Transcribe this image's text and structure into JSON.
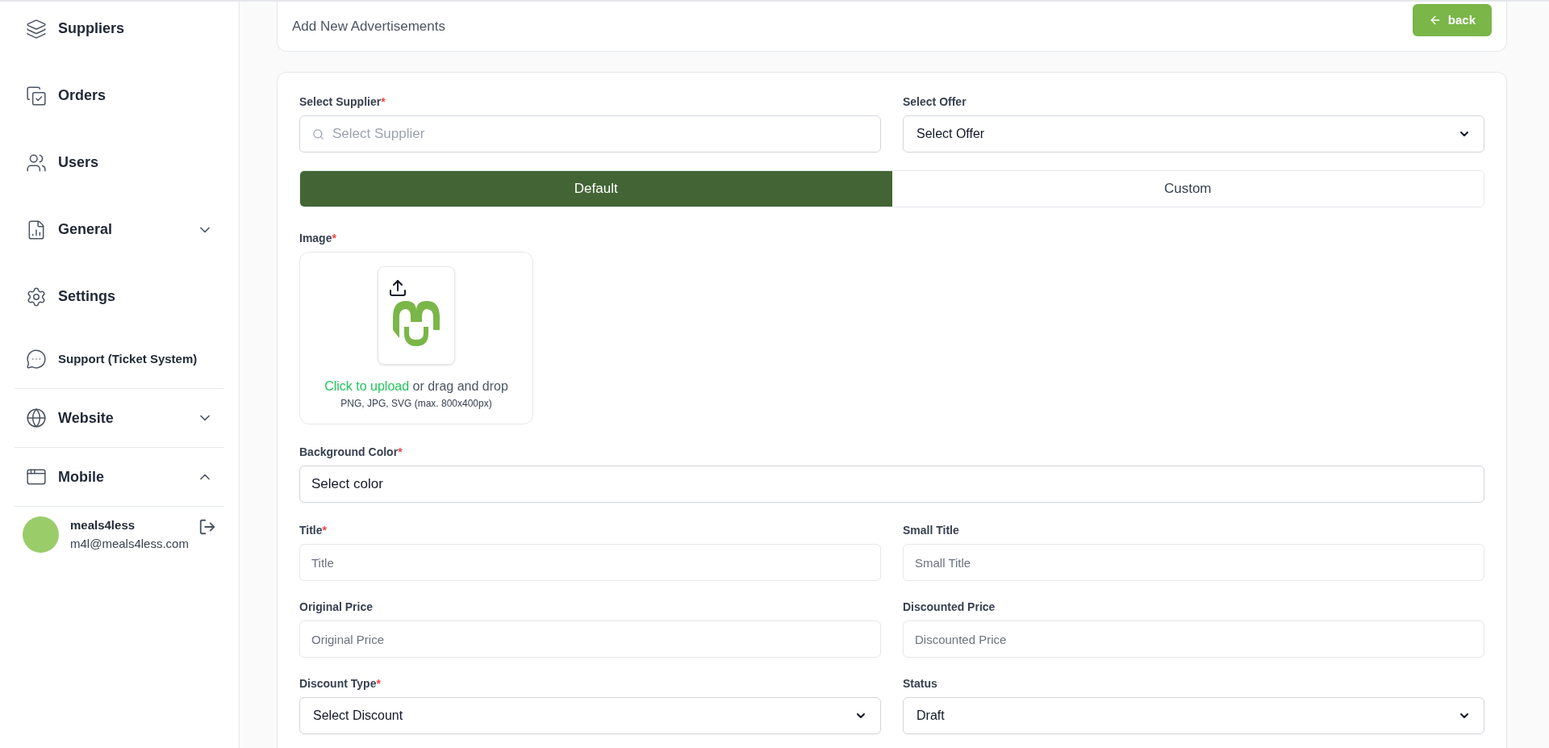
{
  "sidebar": {
    "items": [
      {
        "label": "Suppliers",
        "kind": "link",
        "selected": false
      },
      {
        "label": "Orders",
        "kind": "link",
        "selected": false
      },
      {
        "label": "Users",
        "kind": "link",
        "selected": false
      },
      {
        "label": "General",
        "kind": "group",
        "expanded": false,
        "selected": false
      },
      {
        "label": "Settings",
        "kind": "link",
        "selected": false
      },
      {
        "label": "Support (Ticket System)",
        "kind": "link",
        "selected": false
      },
      {
        "label": "Website",
        "kind": "group",
        "expanded": false,
        "selected": false
      },
      {
        "label": "Mobile",
        "kind": "group",
        "expanded": true,
        "selected": false
      }
    ],
    "user": {
      "name": "meals4less",
      "email": "m4l@meals4less.com"
    }
  },
  "header": {
    "subtitle": "Add New Advertisements",
    "back_button": "back"
  },
  "form": {
    "supplier": {
      "label": "Select Supplier",
      "required_mark": "*",
      "placeholder": "Select Supplier"
    },
    "offer": {
      "label": "Select Offer",
      "value": "Select Offer"
    },
    "modes": [
      {
        "label": "Default",
        "selected": true
      },
      {
        "label": "Custom",
        "selected": false
      }
    ],
    "image": {
      "label": "Image",
      "required_mark": "*",
      "link": "Click to upload",
      "hint": " or drag and drop",
      "formats": "PNG, JPG, SVG (max. 800x400px)"
    },
    "background_color": {
      "label": "Background Color",
      "required_mark": "*",
      "value": "Select color"
    },
    "fields": [
      {
        "label": "Title",
        "required_mark": "*",
        "kind": "text",
        "placeholder": "Title"
      },
      {
        "label": "Small Title",
        "kind": "text",
        "placeholder": "Small Title"
      },
      {
        "label": "Original Price",
        "kind": "text",
        "placeholder": "Original Price"
      },
      {
        "label": "Discounted Price",
        "kind": "text",
        "placeholder": "Discounted Price"
      },
      {
        "label": "Discount Type",
        "required_mark": "*",
        "kind": "select",
        "value": "Select Discount"
      },
      {
        "label": "Status",
        "kind": "select",
        "value": "Draft"
      }
    ]
  }
}
